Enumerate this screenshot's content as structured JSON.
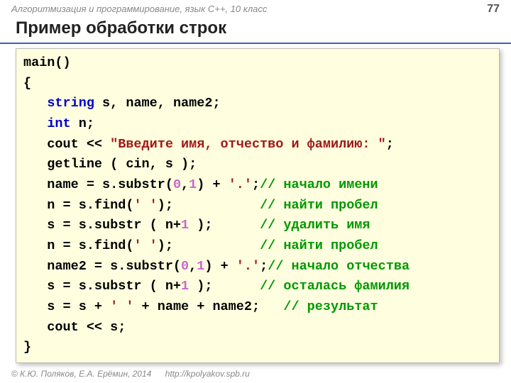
{
  "header": {
    "subject": "Алгоритмизация и программирование, язык C++, 10 класс",
    "page": "77"
  },
  "title": "Пример обработки строк",
  "code": {
    "l1": "main()",
    "l2": "{",
    "l3a": "   ",
    "l3k": "string",
    "l3b": " s, name, name2;",
    "l4a": "   ",
    "l4k": "int",
    "l4b": " n;",
    "l5a": "   cout << ",
    "l5s": "\"Введите имя, отчество и фамилию: \"",
    "l5b": ";",
    "l6": "   getline ( cin, s );",
    "l7a": "   name = s.substr(",
    "l7n1": "0",
    "l7b": ",",
    "l7n2": "1",
    "l7c": ") + ",
    "l7s": "'.'",
    "l7d": ";",
    "l7cm": "// начало имени",
    "l8a": "   n = s.find(",
    "l8s": "' '",
    "l8b": ");           ",
    "l8cm": "// найти пробел",
    "l9a": "   s = s.substr ( n+",
    "l9n": "1",
    "l9b": " );      ",
    "l9cm": "// удалить имя",
    "l10a": "   n = s.find(",
    "l10s": "' '",
    "l10b": ");           ",
    "l10cm": "// найти пробел",
    "l11a": "   name2 = s.substr(",
    "l11n1": "0",
    "l11b": ",",
    "l11n2": "1",
    "l11c": ") + ",
    "l11s": "'.'",
    "l11d": ";",
    "l11cm": "// начало отчества",
    "l12a": "   s = s.substr ( n+",
    "l12n": "1",
    "l12b": " );      ",
    "l12cm": "// осталась фамилия",
    "l13a": "   s = s + ",
    "l13s1": "' '",
    "l13b": " + name + name2;   ",
    "l13cm": "// результат",
    "l14": "   cout << s;",
    "l15": "}"
  },
  "footer": {
    "copy": "© К.Ю. Поляков, Е.А. Ерёмин, 2014",
    "url": "http://kpolyakov.spb.ru"
  }
}
